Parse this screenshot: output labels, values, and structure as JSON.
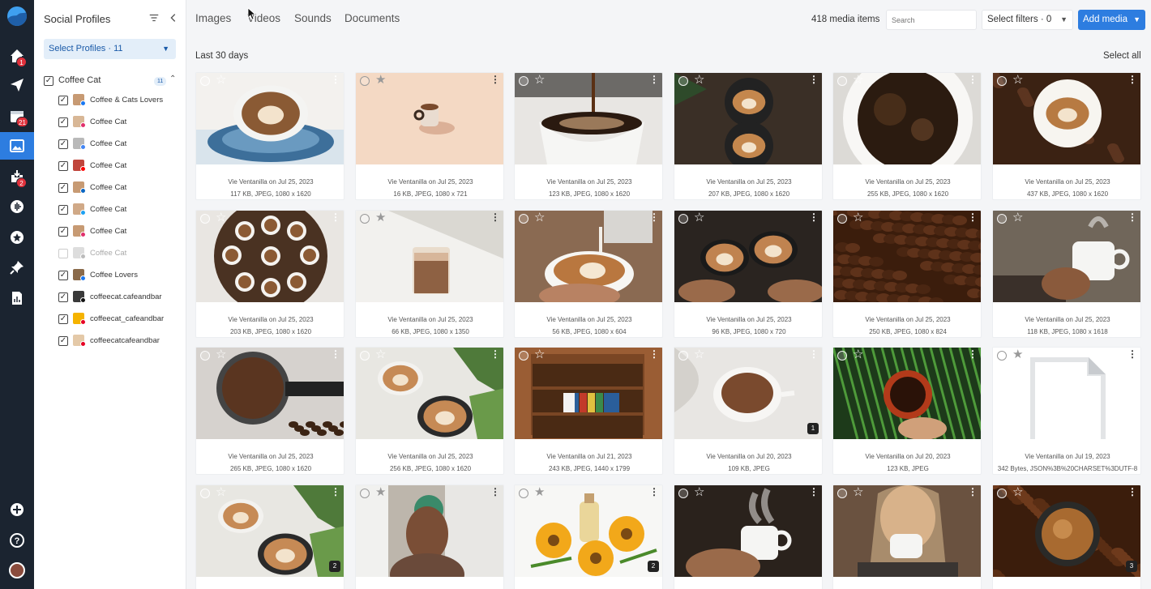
{
  "colors": {
    "rail": "#1b2430",
    "accent": "#2d7de0",
    "badge": "#e0303b",
    "panel_bg": "#ffffff",
    "page_bg": "#f4f5f7"
  },
  "rail": {
    "items": [
      {
        "name": "home-icon",
        "badge": "1"
      },
      {
        "name": "publish-icon",
        "badge": ""
      },
      {
        "name": "calendar-icon",
        "badge": "21"
      },
      {
        "name": "media-library-icon",
        "badge": ""
      },
      {
        "name": "inbox-icon",
        "badge": "2"
      },
      {
        "name": "listening-icon",
        "badge": ""
      },
      {
        "name": "reviews-icon",
        "badge": ""
      },
      {
        "name": "pin-icon",
        "badge": ""
      },
      {
        "name": "reports-icon",
        "badge": ""
      }
    ],
    "bottom": [
      "add-icon",
      "help-icon",
      "avatar"
    ]
  },
  "panel": {
    "title": "Social Profiles",
    "select_label": "Select Profiles · 11",
    "group": {
      "label": "Coffee Cat",
      "count": "11"
    },
    "profiles": [
      {
        "label": "Coffee & Cats Lovers",
        "checked": true,
        "network": "facebook"
      },
      {
        "label": "Coffee Cat",
        "checked": true,
        "network": "instagram"
      },
      {
        "label": "Coffee Cat",
        "checked": true,
        "network": "google-business"
      },
      {
        "label": "Coffee Cat",
        "checked": true,
        "network": "youtube"
      },
      {
        "label": "Coffee Cat",
        "checked": true,
        "network": "linkedin"
      },
      {
        "label": "Coffee Cat",
        "checked": true,
        "network": "twitter"
      },
      {
        "label": "Coffee Cat",
        "checked": true,
        "network": "instagram"
      },
      {
        "label": "Coffee Cat",
        "checked": false,
        "network": "disabled"
      },
      {
        "label": "Coffee Lovers",
        "checked": true,
        "network": "facebook"
      },
      {
        "label": "coffeecat.cafeandbar",
        "checked": true,
        "network": "tiktok"
      },
      {
        "label": "coffeecat_cafeandbar",
        "checked": true,
        "network": "pinterest"
      },
      {
        "label": "coffeecatcafeandbar",
        "checked": true,
        "network": "pinterest"
      }
    ]
  },
  "topbar": {
    "tabs": [
      "Images",
      "Videos",
      "Sounds",
      "Documents"
    ],
    "media_count": "418 media items",
    "search_placeholder": "Search",
    "filters_label": "Select filters · 0",
    "add_media_label": "Add media"
  },
  "section": {
    "label": "Last 30 days",
    "select_all": "Select all"
  },
  "media": [
    {
      "author": "Vie Ventanilla on Jul 25, 2023",
      "info": "117 KB, JPEG, 1080 x 1620",
      "count": "",
      "light": false,
      "img": "cup-blue-saucer"
    },
    {
      "author": "Vie Ventanilla on Jul 25, 2023",
      "info": "16 KB, JPEG, 1080 x 721",
      "count": "",
      "light": true,
      "img": "cup-peach-bg"
    },
    {
      "author": "Vie Ventanilla on Jul 25, 2023",
      "info": "123 KB, JPEG, 1080 x 1620",
      "count": "",
      "light": false,
      "img": "pouring-coffee"
    },
    {
      "author": "Vie Ventanilla on Jul 25, 2023",
      "info": "207 KB, JPEG, 1080 x 1620",
      "count": "",
      "light": false,
      "img": "two-lattes-top"
    },
    {
      "author": "Vie Ventanilla on Jul 25, 2023",
      "info": "255 KB, JPEG, 1080 x 1620",
      "count": "",
      "light": false,
      "img": "black-coffee-top"
    },
    {
      "author": "Vie Ventanilla on Jul 25, 2023",
      "info": "437 KB, JPEG, 1080 x 1620",
      "count": "",
      "light": false,
      "img": "latte-beans"
    },
    {
      "author": "Vie Ventanilla on Jul 25, 2023",
      "info": "203 KB, JPEG, 1080 x 1620",
      "count": "",
      "light": false,
      "img": "cups-round-table"
    },
    {
      "author": "Vie Ventanilla on Jul 25, 2023",
      "info": "66 KB, JPEG, 1080 x 1350",
      "count": "",
      "light": true,
      "img": "iced-coffee-glass"
    },
    {
      "author": "Vie Ventanilla on Jul 25, 2023",
      "info": "56 KB, JPEG, 1080 x 604",
      "count": "",
      "light": false,
      "img": "milk-pour-latte"
    },
    {
      "author": "Vie Ventanilla on Jul 25, 2023",
      "info": "96 KB, JPEG, 1080 x 720",
      "count": "",
      "light": false,
      "img": "hands-two-lattes"
    },
    {
      "author": "Vie Ventanilla on Jul 25, 2023",
      "info": "250 KB, JPEG, 1080 x 824",
      "count": "",
      "light": false,
      "img": "coffee-beans"
    },
    {
      "author": "Vie Ventanilla on Jul 25, 2023",
      "info": "118 KB, JPEG, 1080 x 1618",
      "count": "",
      "light": false,
      "img": "hand-white-cup"
    },
    {
      "author": "Vie Ventanilla on Jul 25, 2023",
      "info": "265 KB, JPEG, 1080 x 1620",
      "count": "",
      "light": false,
      "img": "portafilter-grounds"
    },
    {
      "author": "Vie Ventanilla on Jul 25, 2023",
      "info": "256 KB, JPEG, 1080 x 1620",
      "count": "",
      "light": false,
      "img": "lattes-plants"
    },
    {
      "author": "Vie Ventanilla on Jul 21, 2023",
      "info": "243 KB, JPEG, 1440 x 1799",
      "count": "",
      "light": false,
      "img": "bookshelf"
    },
    {
      "author": "Vie Ventanilla on Jul 20, 2023",
      "info": "109 KB, JPEG",
      "count": "1",
      "light": false,
      "img": "tea-cup-linen"
    },
    {
      "author": "Vie Ventanilla on Jul 20, 2023",
      "info": "123 KB, JPEG",
      "count": "",
      "light": false,
      "img": "coffee-fern"
    },
    {
      "author": "Vie Ventanilla on Jul 19, 2023",
      "info": "342 Bytes, JSON%3B%20CHARSET%3DUTF-8",
      "count": "",
      "light": true,
      "img": "document"
    },
    {
      "author": "",
      "info": "",
      "count": "2",
      "light": false,
      "img": "lattes-plants-2"
    },
    {
      "author": "",
      "info": "",
      "count": "",
      "light": true,
      "img": "person-hands-face"
    },
    {
      "author": "",
      "info": "",
      "count": "2",
      "light": true,
      "img": "flowers-oil"
    },
    {
      "author": "",
      "info": "",
      "count": "",
      "light": false,
      "img": "steaming-cup-hand"
    },
    {
      "author": "",
      "info": "",
      "count": "",
      "light": false,
      "img": "woman-cup"
    },
    {
      "author": "",
      "info": "",
      "count": "3",
      "light": false,
      "img": "beans-jar"
    }
  ]
}
